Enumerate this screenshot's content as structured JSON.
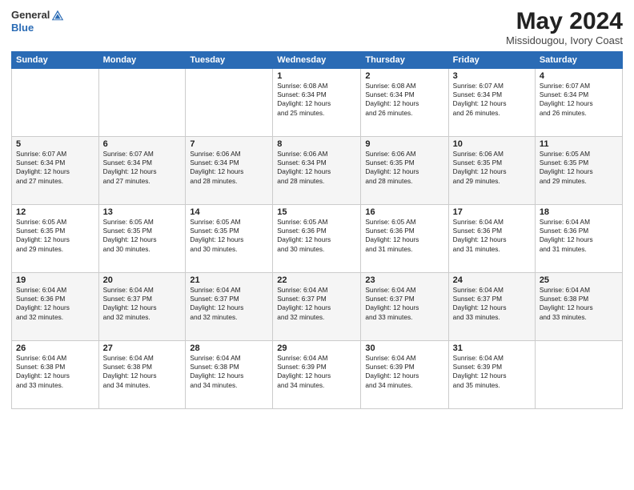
{
  "logo": {
    "text1": "General",
    "text2": "Blue"
  },
  "calendar": {
    "title": "May 2024",
    "subtitle": "Missidougou, Ivory Coast",
    "headers": [
      "Sunday",
      "Monday",
      "Tuesday",
      "Wednesday",
      "Thursday",
      "Friday",
      "Saturday"
    ],
    "weeks": [
      [
        {
          "day": "",
          "info": ""
        },
        {
          "day": "",
          "info": ""
        },
        {
          "day": "",
          "info": ""
        },
        {
          "day": "1",
          "info": "Sunrise: 6:08 AM\nSunset: 6:34 PM\nDaylight: 12 hours\nand 25 minutes."
        },
        {
          "day": "2",
          "info": "Sunrise: 6:08 AM\nSunset: 6:34 PM\nDaylight: 12 hours\nand 26 minutes."
        },
        {
          "day": "3",
          "info": "Sunrise: 6:07 AM\nSunset: 6:34 PM\nDaylight: 12 hours\nand 26 minutes."
        },
        {
          "day": "4",
          "info": "Sunrise: 6:07 AM\nSunset: 6:34 PM\nDaylight: 12 hours\nand 26 minutes."
        }
      ],
      [
        {
          "day": "5",
          "info": "Sunrise: 6:07 AM\nSunset: 6:34 PM\nDaylight: 12 hours\nand 27 minutes."
        },
        {
          "day": "6",
          "info": "Sunrise: 6:07 AM\nSunset: 6:34 PM\nDaylight: 12 hours\nand 27 minutes."
        },
        {
          "day": "7",
          "info": "Sunrise: 6:06 AM\nSunset: 6:34 PM\nDaylight: 12 hours\nand 28 minutes."
        },
        {
          "day": "8",
          "info": "Sunrise: 6:06 AM\nSunset: 6:34 PM\nDaylight: 12 hours\nand 28 minutes."
        },
        {
          "day": "9",
          "info": "Sunrise: 6:06 AM\nSunset: 6:35 PM\nDaylight: 12 hours\nand 28 minutes."
        },
        {
          "day": "10",
          "info": "Sunrise: 6:06 AM\nSunset: 6:35 PM\nDaylight: 12 hours\nand 29 minutes."
        },
        {
          "day": "11",
          "info": "Sunrise: 6:05 AM\nSunset: 6:35 PM\nDaylight: 12 hours\nand 29 minutes."
        }
      ],
      [
        {
          "day": "12",
          "info": "Sunrise: 6:05 AM\nSunset: 6:35 PM\nDaylight: 12 hours\nand 29 minutes."
        },
        {
          "day": "13",
          "info": "Sunrise: 6:05 AM\nSunset: 6:35 PM\nDaylight: 12 hours\nand 30 minutes."
        },
        {
          "day": "14",
          "info": "Sunrise: 6:05 AM\nSunset: 6:35 PM\nDaylight: 12 hours\nand 30 minutes."
        },
        {
          "day": "15",
          "info": "Sunrise: 6:05 AM\nSunset: 6:36 PM\nDaylight: 12 hours\nand 30 minutes."
        },
        {
          "day": "16",
          "info": "Sunrise: 6:05 AM\nSunset: 6:36 PM\nDaylight: 12 hours\nand 31 minutes."
        },
        {
          "day": "17",
          "info": "Sunrise: 6:04 AM\nSunset: 6:36 PM\nDaylight: 12 hours\nand 31 minutes."
        },
        {
          "day": "18",
          "info": "Sunrise: 6:04 AM\nSunset: 6:36 PM\nDaylight: 12 hours\nand 31 minutes."
        }
      ],
      [
        {
          "day": "19",
          "info": "Sunrise: 6:04 AM\nSunset: 6:36 PM\nDaylight: 12 hours\nand 32 minutes."
        },
        {
          "day": "20",
          "info": "Sunrise: 6:04 AM\nSunset: 6:37 PM\nDaylight: 12 hours\nand 32 minutes."
        },
        {
          "day": "21",
          "info": "Sunrise: 6:04 AM\nSunset: 6:37 PM\nDaylight: 12 hours\nand 32 minutes."
        },
        {
          "day": "22",
          "info": "Sunrise: 6:04 AM\nSunset: 6:37 PM\nDaylight: 12 hours\nand 32 minutes."
        },
        {
          "day": "23",
          "info": "Sunrise: 6:04 AM\nSunset: 6:37 PM\nDaylight: 12 hours\nand 33 minutes."
        },
        {
          "day": "24",
          "info": "Sunrise: 6:04 AM\nSunset: 6:37 PM\nDaylight: 12 hours\nand 33 minutes."
        },
        {
          "day": "25",
          "info": "Sunrise: 6:04 AM\nSunset: 6:38 PM\nDaylight: 12 hours\nand 33 minutes."
        }
      ],
      [
        {
          "day": "26",
          "info": "Sunrise: 6:04 AM\nSunset: 6:38 PM\nDaylight: 12 hours\nand 33 minutes."
        },
        {
          "day": "27",
          "info": "Sunrise: 6:04 AM\nSunset: 6:38 PM\nDaylight: 12 hours\nand 34 minutes."
        },
        {
          "day": "28",
          "info": "Sunrise: 6:04 AM\nSunset: 6:38 PM\nDaylight: 12 hours\nand 34 minutes."
        },
        {
          "day": "29",
          "info": "Sunrise: 6:04 AM\nSunset: 6:39 PM\nDaylight: 12 hours\nand 34 minutes."
        },
        {
          "day": "30",
          "info": "Sunrise: 6:04 AM\nSunset: 6:39 PM\nDaylight: 12 hours\nand 34 minutes."
        },
        {
          "day": "31",
          "info": "Sunrise: 6:04 AM\nSunset: 6:39 PM\nDaylight: 12 hours\nand 35 minutes."
        },
        {
          "day": "",
          "info": ""
        }
      ]
    ]
  }
}
